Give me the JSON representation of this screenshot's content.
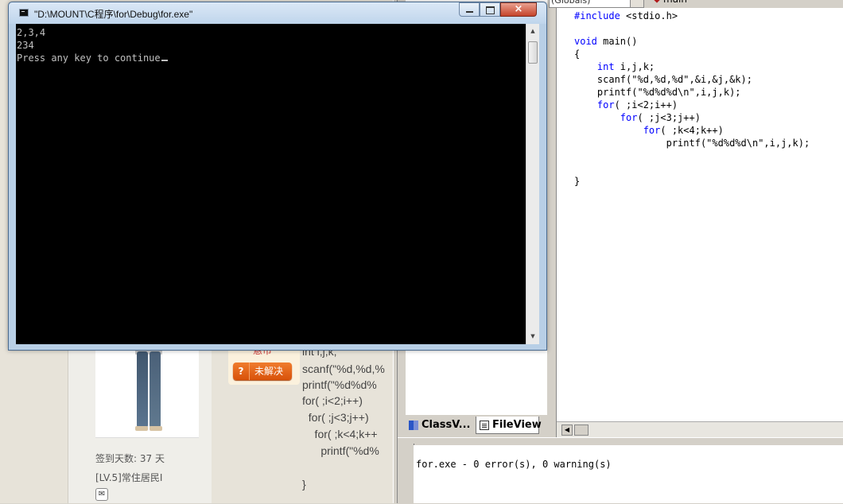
{
  "console": {
    "title": "\"D:\\MOUNT\\C程序\\for\\Debug\\for.exe\"",
    "lines": [
      "2,3,4",
      "234",
      "Press any key to continue"
    ],
    "close_glyph": "×"
  },
  "background_page": {
    "sign_days": "签到天数: 37 天",
    "level": "[LV.5]常住居民I",
    "reward_text": "悬币",
    "unsolved_icon": "?",
    "unsolved_label": "未解决",
    "code_lines": [
      "int i,j,k;",
      "scanf(\"%d,%d,%",
      "printf(\"%d%d%",
      "for( ;i<2;i++)",
      "  for( ;j<3;j++)",
      "    for( ;k<4;k++",
      "      printf(\"%d%",
      "",
      "}"
    ]
  },
  "ide": {
    "toolbar_combo": "(Globals)",
    "toolbar_func": "main",
    "editor_lines": [
      {
        "kw": "#include",
        "rest": " <stdio.h>"
      },
      {
        "kw": "",
        "rest": ""
      },
      {
        "kw": "void",
        "rest": " main()"
      },
      {
        "kw": "",
        "rest": "{"
      },
      {
        "kw": "    int",
        "rest": " i,j,k;"
      },
      {
        "kw": "",
        "rest": "    scanf(\"%d,%d,%d\",&i,&j,&k);"
      },
      {
        "kw": "",
        "rest": "    printf(\"%d%d%d\\n\",i,j,k);"
      },
      {
        "kw": "    for",
        "rest": "( ;i<2;i++)"
      },
      {
        "kw": "        for",
        "rest": "( ;j<3;j++)"
      },
      {
        "kw": "            for",
        "rest": "( ;k<4;k++)"
      },
      {
        "kw": "",
        "rest": "                printf(\"%d%d%d\\n\",i,j,k);"
      },
      {
        "kw": "",
        "rest": ""
      },
      {
        "kw": "",
        "rest": ""
      },
      {
        "kw": "",
        "rest": "}"
      }
    ],
    "tabs": {
      "classview": "ClassV...",
      "fileview": "FileView"
    },
    "output": "for.exe - 0 error(s), 0 warning(s)"
  }
}
